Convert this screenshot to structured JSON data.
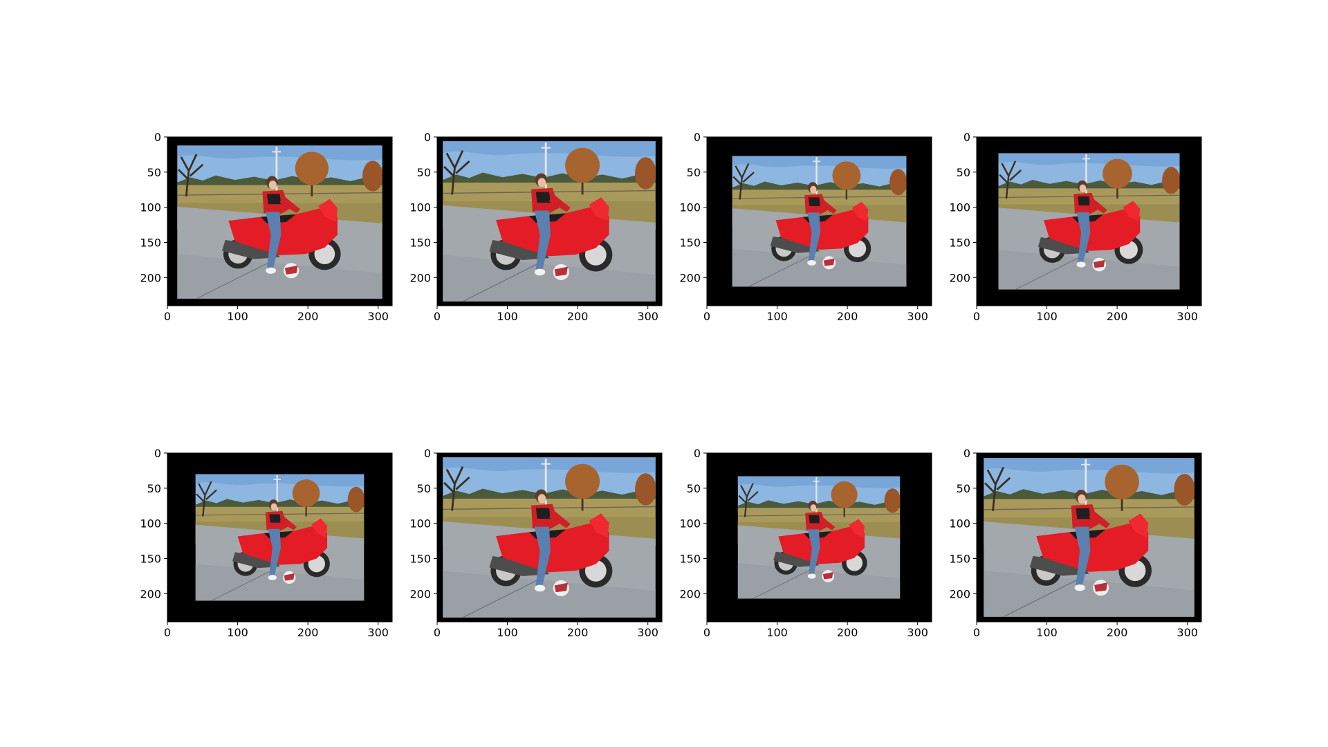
{
  "figure": {
    "rows": 2,
    "cols": 4,
    "background": "#ffffff"
  },
  "chart_data": [
    {
      "type": "image",
      "xlim": [
        0,
        320
      ],
      "ylim": [
        240,
        0
      ],
      "xticks": [
        0,
        100,
        200,
        300
      ],
      "yticks": [
        0,
        50,
        100,
        150,
        200
      ],
      "xtick_labels": [
        "0",
        "100",
        "200",
        "300"
      ],
      "ytick_labels": [
        "0",
        "50",
        "100",
        "150",
        "200"
      ],
      "photo_extent": {
        "x": [
          14,
          306
        ],
        "y": [
          12,
          230
        ]
      },
      "pad_color": "#000000"
    },
    {
      "type": "image",
      "xlim": [
        0,
        320
      ],
      "ylim": [
        240,
        0
      ],
      "xticks": [
        0,
        100,
        200,
        300
      ],
      "yticks": [
        0,
        50,
        100,
        150,
        200
      ],
      "xtick_labels": [
        "0",
        "100",
        "200",
        "300"
      ],
      "ytick_labels": [
        "0",
        "50",
        "100",
        "150",
        "200"
      ],
      "photo_extent": {
        "x": [
          8,
          311
        ],
        "y": [
          6,
          234
        ]
      },
      "pad_color": "#000000"
    },
    {
      "type": "image",
      "xlim": [
        0,
        320
      ],
      "ylim": [
        240,
        0
      ],
      "xticks": [
        0,
        100,
        200,
        300
      ],
      "yticks": [
        0,
        50,
        100,
        150,
        200
      ],
      "xtick_labels": [
        "0",
        "100",
        "200",
        "300"
      ],
      "ytick_labels": [
        "0",
        "50",
        "100",
        "150",
        "200"
      ],
      "photo_extent": {
        "x": [
          36,
          284
        ],
        "y": [
          27,
          213
        ]
      },
      "pad_color": "#000000"
    },
    {
      "type": "image",
      "xlim": [
        0,
        320
      ],
      "ylim": [
        240,
        0
      ],
      "xticks": [
        0,
        100,
        200,
        300
      ],
      "yticks": [
        0,
        50,
        100,
        150,
        200
      ],
      "xtick_labels": [
        "0",
        "100",
        "200",
        "300"
      ],
      "ytick_labels": [
        "0",
        "50",
        "100",
        "150",
        "200"
      ],
      "photo_extent": {
        "x": [
          31,
          289
        ],
        "y": [
          23,
          217
        ]
      },
      "pad_color": "#000000"
    },
    {
      "type": "image",
      "xlim": [
        0,
        320
      ],
      "ylim": [
        240,
        0
      ],
      "xticks": [
        0,
        100,
        200,
        300
      ],
      "yticks": [
        0,
        50,
        100,
        150,
        200
      ],
      "xtick_labels": [
        "0",
        "100",
        "200",
        "300"
      ],
      "ytick_labels": [
        "0",
        "50",
        "100",
        "150",
        "200"
      ],
      "photo_extent": {
        "x": [
          40,
          280
        ],
        "y": [
          30,
          210
        ]
      },
      "pad_color": "#000000"
    },
    {
      "type": "image",
      "xlim": [
        0,
        320
      ],
      "ylim": [
        240,
        0
      ],
      "xticks": [
        0,
        100,
        200,
        300
      ],
      "yticks": [
        0,
        50,
        100,
        150,
        200
      ],
      "xtick_labels": [
        "0",
        "100",
        "200",
        "300"
      ],
      "ytick_labels": [
        "0",
        "50",
        "100",
        "150",
        "200"
      ],
      "photo_extent": {
        "x": [
          8,
          311
        ],
        "y": [
          6,
          234
        ]
      },
      "pad_color": "#000000"
    },
    {
      "type": "image",
      "xlim": [
        0,
        320
      ],
      "ylim": [
        240,
        0
      ],
      "xticks": [
        0,
        100,
        200,
        300
      ],
      "yticks": [
        0,
        50,
        100,
        150,
        200
      ],
      "xtick_labels": [
        "0",
        "100",
        "200",
        "300"
      ],
      "ytick_labels": [
        "0",
        "50",
        "100",
        "150",
        "200"
      ],
      "photo_extent": {
        "x": [
          44,
          275
        ],
        "y": [
          33,
          207
        ]
      },
      "pad_color": "#000000"
    },
    {
      "type": "image",
      "xlim": [
        0,
        320
      ],
      "ylim": [
        240,
        0
      ],
      "xticks": [
        0,
        100,
        200,
        300
      ],
      "yticks": [
        0,
        50,
        100,
        150,
        200
      ],
      "xtick_labels": [
        "0",
        "100",
        "200",
        "300"
      ],
      "ytick_labels": [
        "0",
        "50",
        "100",
        "150",
        "200"
      ],
      "photo_extent": {
        "x": [
          10,
          310
        ],
        "y": [
          7,
          233
        ]
      },
      "pad_color": "#000000"
    }
  ],
  "colors": {
    "sky": "#8db7e0",
    "grass": "#a99a5c",
    "pavement": "#a3a8ad",
    "motorcycle": "#e31c25",
    "jacket": "#d01f26",
    "jeans": "#5b7fae",
    "tree_autumn": "#a8642e",
    "axis": "#000000"
  }
}
